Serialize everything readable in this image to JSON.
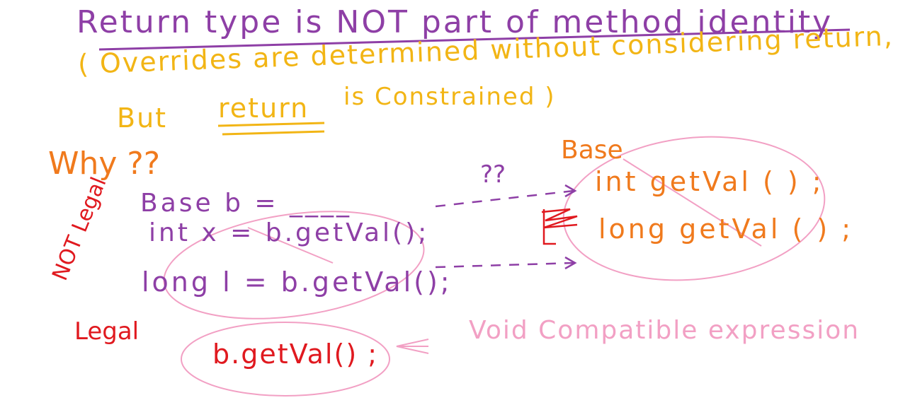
{
  "colors": {
    "purple": "#8e3fa6",
    "orange": "#f07a1d",
    "yellow": "#f2b515",
    "pink": "#f2a0c4",
    "red": "#e0191f"
  },
  "heading": "Return type is NOT part of method identity",
  "note_line1": "( Overrides are determined without considering return,",
  "note_line2_prefix": "But",
  "note_line2_word": "return",
  "note_line2_suffix": "is Constrained )",
  "why": "Why ??",
  "code": {
    "decl": "Base b = ____",
    "line_int": "int x = b.getVal();",
    "line_long": "long l = b.getVal();",
    "call": "b.getVal() ;",
    "question": "??"
  },
  "base_class": {
    "title": "Base",
    "method_int": "int getVal ( ) ;",
    "method_long": "long getVal ( ) ;"
  },
  "labels": {
    "not_legal": "NOT Legal",
    "legal": "Legal",
    "void_expr": "Void Compatible expression"
  }
}
